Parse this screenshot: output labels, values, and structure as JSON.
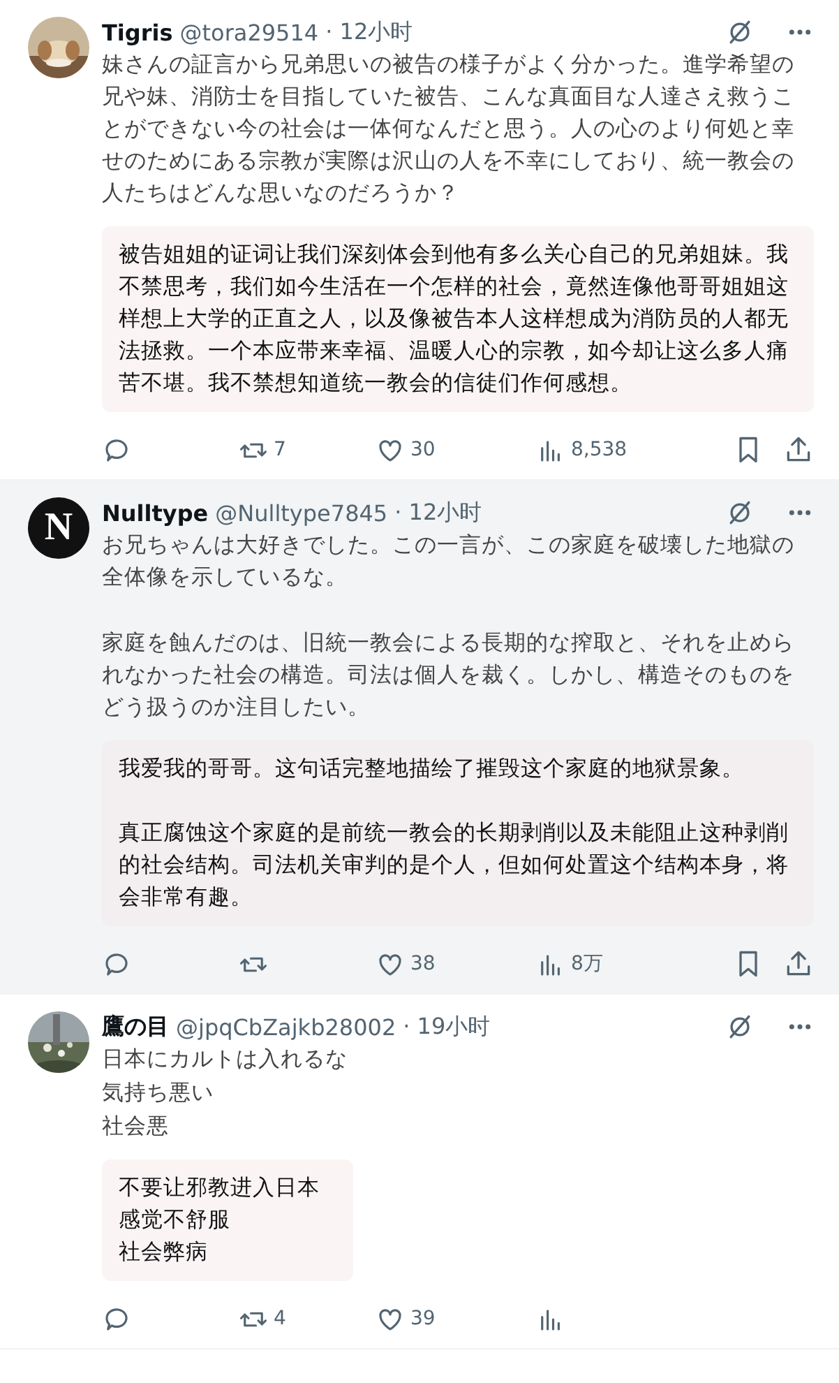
{
  "tweets": [
    {
      "highlighted": false,
      "avatar": {
        "kind": "picture"
      },
      "name": "Tigris",
      "handle": "@tora29514",
      "time": "· 12小时",
      "paragraphs": [
        "妹さんの証言から兄弟思いの被告の様子がよく分かった。進学希望の兄や妹、消防士を目指していた被告、こんな真面目な人達さえ救うことができない今の社会は一体何なんだと思う。人の心のより何処と幸せのためにある宗教が実際は沢山の人を不幸にしており、統一教会の人たちはどんな思いなのだろうか？"
      ],
      "quote": {
        "wide": true,
        "paragraphs": [
          "被告姐姐的证词让我们深刻体会到他有多么关心自己的兄弟姐妹。我不禁思考，我们如今生活在一个怎样的社会，竟然连像他哥哥姐姐这样想上大学的正直之人，以及像被告本人这样想成为消防员的人都无法拯救。一个本应带来幸福、温暖人心的宗教，如今却让这么多人痛苦不堪。我不禁想知道统一教会的信徒们作何感想。"
        ]
      },
      "actions": {
        "reposts": "7",
        "likes": "30",
        "views": "8,538"
      }
    },
    {
      "highlighted": true,
      "avatar": {
        "kind": "letter",
        "letter": "N"
      },
      "name": "Nulltype",
      "handle": "@Nulltype7845",
      "time": "· 12小时",
      "paragraphs": [
        "お兄ちゃんは大好きでした。この一言が、この家庭を破壊した地獄の全体像を示しているな。",
        "家庭を蝕んだのは、旧統一教会による長期的な搾取と、それを止められなかった社会の構造。司法は個人を裁く。しかし、構造そのものをどう扱うのか注目したい。"
      ],
      "quote": {
        "wide": true,
        "paragraphs": [
          "我爱我的哥哥。这句话完整地描绘了摧毁这个家庭的地狱景象。",
          "真正腐蚀这个家庭的是前统一教会的长期剥削以及未能阻止这种剥削的社会结构。司法机关审判的是个人，但如何处置这个结构本身，将会非常有趣。"
        ]
      },
      "actions": {
        "likes": "38",
        "views": "8万"
      }
    },
    {
      "highlighted": false,
      "avatar": {
        "kind": "picture"
      },
      "name": "鷹の目",
      "handle": "@jpqCbZajkb28002",
      "time": "· 19小时",
      "paragraphs": [
        "日本にカルトは入れるな",
        "気持ち悪い",
        "社会悪"
      ],
      "tight": true,
      "quote": {
        "wide": false,
        "paragraphs": [
          "不要让邪教进入日本",
          "感觉不舒服",
          "社会弊病"
        ]
      },
      "actions": {
        "reposts": "4",
        "likes": "39"
      }
    }
  ]
}
